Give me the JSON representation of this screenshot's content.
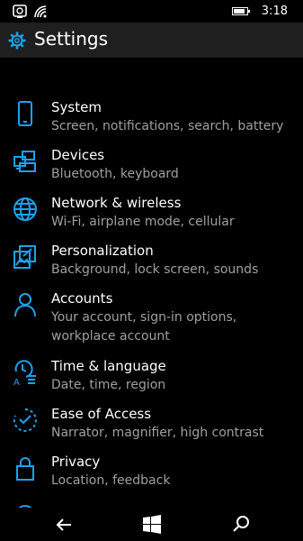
{
  "status_bar": {
    "time": "3:18",
    "icons": [
      "notification-icon",
      "wifi-icon",
      "battery-icon"
    ]
  },
  "header": {
    "icon": "gear-icon",
    "title": "Settings"
  },
  "items": [
    {
      "title": "System",
      "subtitle": "Screen, notifications, search, battery",
      "icon": "phone-icon"
    },
    {
      "title": "Devices",
      "subtitle": "Bluetooth, keyboard",
      "icon": "devices-icon"
    },
    {
      "title": "Network & wireless",
      "subtitle": "Wi-Fi, airplane mode, cellular",
      "icon": "globe-icon"
    },
    {
      "title": "Personalization",
      "subtitle": "Background, lock screen, sounds",
      "icon": "personalization-icon"
    },
    {
      "title": "Accounts",
      "subtitle": "Your account, sign-in options,",
      "subtitle2": "workplace account",
      "icon": "person-icon"
    },
    {
      "title": "Time & language",
      "subtitle": "Date, time, region",
      "icon": "time-language-icon"
    },
    {
      "title": "Ease of Access",
      "subtitle": "Narrator, magnifier, high contrast",
      "icon": "ease-of-access-icon"
    },
    {
      "title": "Privacy",
      "subtitle": "Location, feedback",
      "icon": "lock-icon"
    }
  ],
  "nav_bar": {
    "buttons": [
      "back-arrow-icon",
      "windows-start-icon",
      "search-icon"
    ]
  },
  "colors": {
    "accent": "#1aa3ef",
    "background": "#000000",
    "header": "#1f1f1f",
    "subtitle": "#a0a0a0"
  }
}
